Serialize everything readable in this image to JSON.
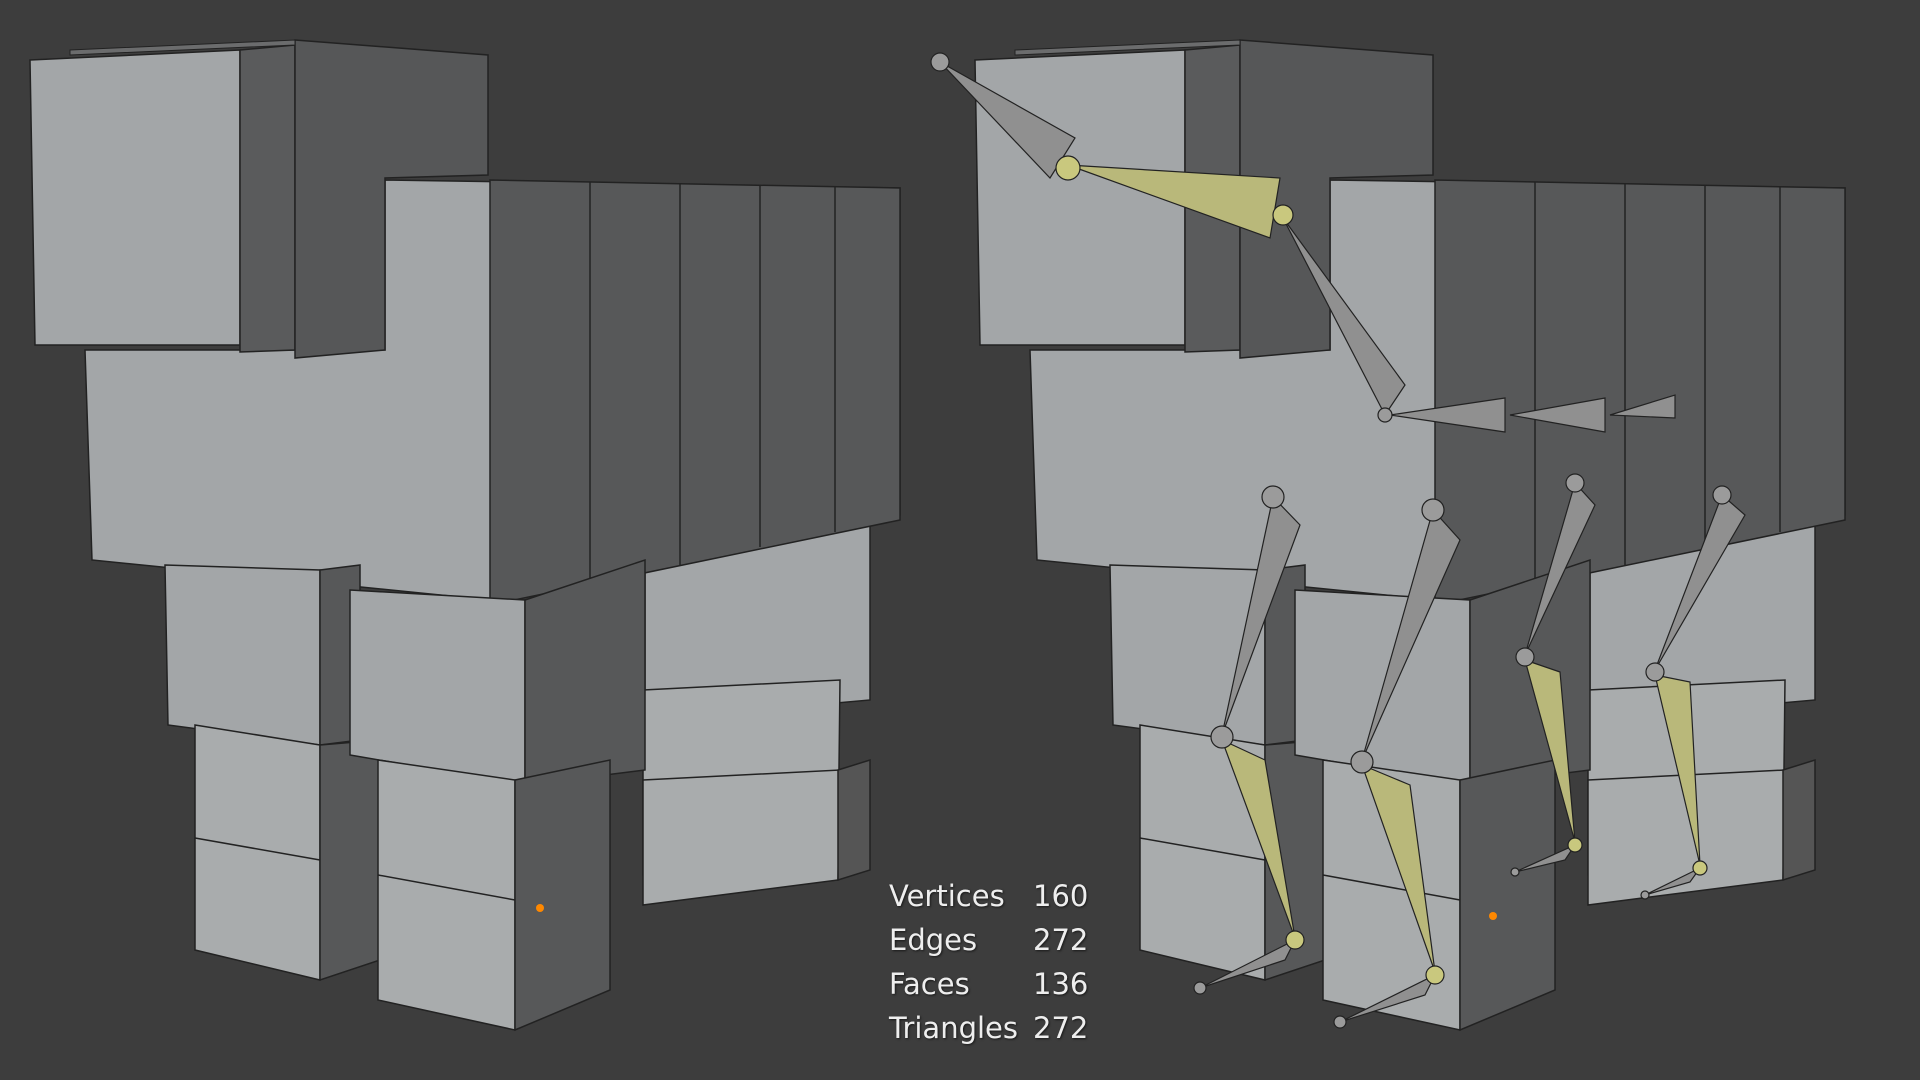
{
  "viewport": {
    "background": "#3d3d3d",
    "models": [
      {
        "name": "mesh-model",
        "rigged": false
      },
      {
        "name": "rigged-model",
        "rigged": true
      }
    ],
    "origin_marker_color": "#ff8800",
    "selected_bone_color": "#b9b87a",
    "bone_color": "#8c8c8c"
  },
  "stats": {
    "vertices": {
      "label": "Vertices",
      "value": "160"
    },
    "edges": {
      "label": "Edges",
      "value": "272"
    },
    "faces": {
      "label": "Faces",
      "value": "136"
    },
    "triangles": {
      "label": "Triangles",
      "value": "272"
    }
  }
}
